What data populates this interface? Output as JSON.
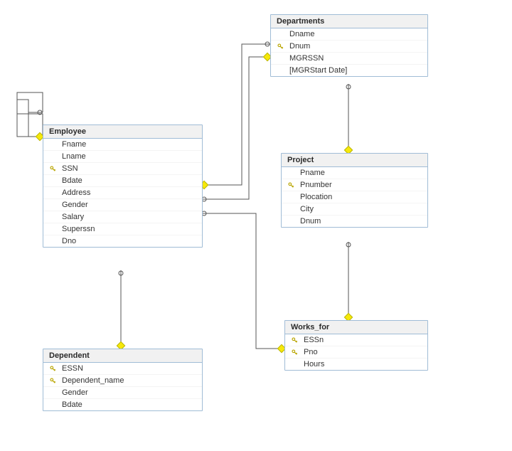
{
  "tables": {
    "departments": {
      "title": "Departments",
      "fields": [
        {
          "name": "Dname",
          "pk": false
        },
        {
          "name": "Dnum",
          "pk": true
        },
        {
          "name": "MGRSSN",
          "pk": false
        },
        {
          "name": "[MGRStart Date]",
          "pk": false
        }
      ]
    },
    "employee": {
      "title": "Employee",
      "fields": [
        {
          "name": "Fname",
          "pk": false
        },
        {
          "name": "Lname",
          "pk": false
        },
        {
          "name": "SSN",
          "pk": true
        },
        {
          "name": "Bdate",
          "pk": false
        },
        {
          "name": "Address",
          "pk": false
        },
        {
          "name": "Gender",
          "pk": false
        },
        {
          "name": "Salary",
          "pk": false
        },
        {
          "name": "Superssn",
          "pk": false
        },
        {
          "name": "Dno",
          "pk": false
        }
      ]
    },
    "project": {
      "title": "Project",
      "fields": [
        {
          "name": "Pname",
          "pk": false
        },
        {
          "name": "Pnumber",
          "pk": true
        },
        {
          "name": "Plocation",
          "pk": false
        },
        {
          "name": "City",
          "pk": false
        },
        {
          "name": "Dnum",
          "pk": false
        }
      ]
    },
    "works_for": {
      "title": "Works_for",
      "fields": [
        {
          "name": "ESSn",
          "pk": true
        },
        {
          "name": "Pno",
          "pk": true
        },
        {
          "name": "Hours",
          "pk": false
        }
      ]
    },
    "dependent": {
      "title": "Dependent",
      "fields": [
        {
          "name": "ESSN",
          "pk": true
        },
        {
          "name": "Dependent_name",
          "pk": true
        },
        {
          "name": "Gender",
          "pk": false
        },
        {
          "name": "Bdate",
          "pk": false
        }
      ]
    }
  }
}
